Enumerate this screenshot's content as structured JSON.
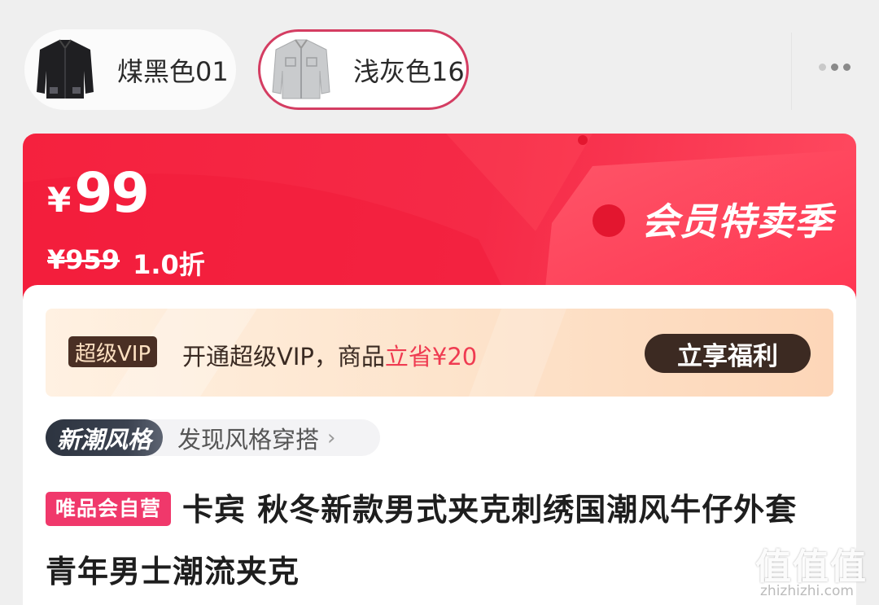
{
  "variants": [
    {
      "label": "煤黑色01",
      "color": "#1f1f22",
      "selected": false
    },
    {
      "label": "浅灰色16",
      "color": "#c9cbcd",
      "selected": true
    }
  ],
  "price": {
    "currency": "¥",
    "current": "99",
    "original": "¥959",
    "discount": "1.0折",
    "event": "会员特卖季"
  },
  "vip": {
    "badge": "超级VIP",
    "text_prefix": "开通超级VIP，商品",
    "text_highlight": "立省¥20",
    "button": "立享福利"
  },
  "style": {
    "tag": "新潮风格",
    "link": "发现风格穿搭"
  },
  "product": {
    "seller_tag": "唯品会自营",
    "title": "卡宾 秋冬新款男式夹克刺绣国潮风牛仔外套青年男士潮流夹克"
  },
  "watermark": {
    "glyphs": "值值值",
    "url": "zhizhizhi.com"
  },
  "colors": {
    "accent_red": "#f5213e",
    "selected_border": "#d43d62",
    "vip_dark": "#3c2a22",
    "seller_pink": "#f0386b"
  }
}
